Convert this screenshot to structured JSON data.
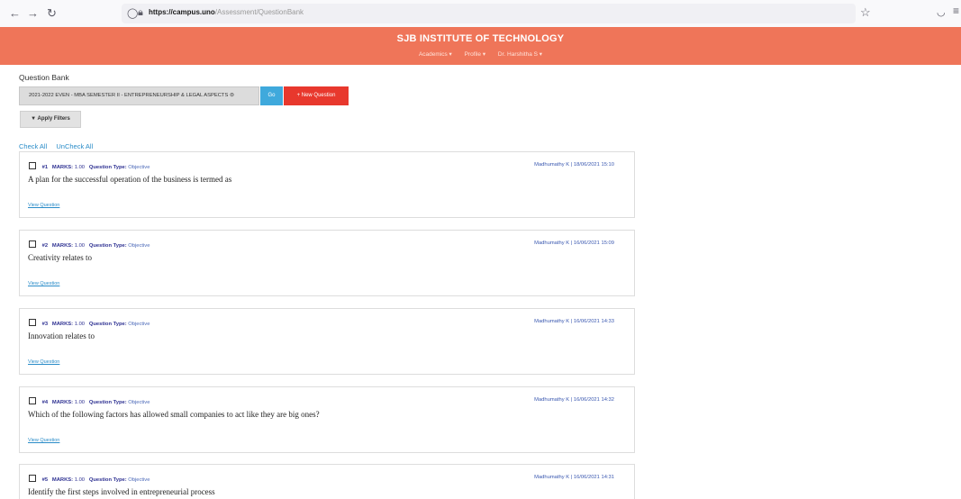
{
  "browser": {
    "back": "←",
    "forward": "→",
    "reload": "↻",
    "url_host": "https://campus.uno",
    "url_path": "/Assessment/QuestionBank"
  },
  "header": {
    "title": "SJB INSTITUTE OF TECHNOLOGY",
    "nav": [
      "Academics ▾",
      "Profile ▾",
      "Dr. Harshitha S ▾"
    ]
  },
  "page": {
    "title": "Question Bank",
    "course": "2021-2022 EVEN - MBA SEMESTER II - ENTREPRENEURSHIP & LEGAL ASPECTS",
    "go_label": "Go",
    "new_question_label": "+ New Question",
    "apply_filters_label": "▼ Apply Filters",
    "check_all": "Check All",
    "uncheck_all": "UnCheck All"
  },
  "labels": {
    "marks": "MARKS:",
    "question_type": "Question Type:",
    "view_question": "View Question"
  },
  "questions": [
    {
      "num": "#1",
      "marks": "1.00",
      "type": "Objective",
      "author": "Madhumathy K",
      "date": "18/06/2021 15:10",
      "text": "A plan for the successful operation of the business is termed as"
    },
    {
      "num": "#2",
      "marks": "1.00",
      "type": "Objective",
      "author": "Madhumathy K",
      "date": "16/06/2021 15:09",
      "text": "Creativity relates to"
    },
    {
      "num": "#3",
      "marks": "1.00",
      "type": "Objective",
      "author": "Madhumathy K",
      "date": "16/06/2021 14:33",
      "text": "Innovation relates to"
    },
    {
      "num": "#4",
      "marks": "1.00",
      "type": "Objective",
      "author": "Madhumathy K",
      "date": "16/06/2021 14:32",
      "text": "Which of the following factors has allowed small companies to act like they are big ones?"
    },
    {
      "num": "#5",
      "marks": "1.00",
      "type": "Objective",
      "author": "Madhumathy K",
      "date": "16/06/2021 14:31",
      "text": "Identify the first  steps involved in entrepreneurial process"
    }
  ]
}
